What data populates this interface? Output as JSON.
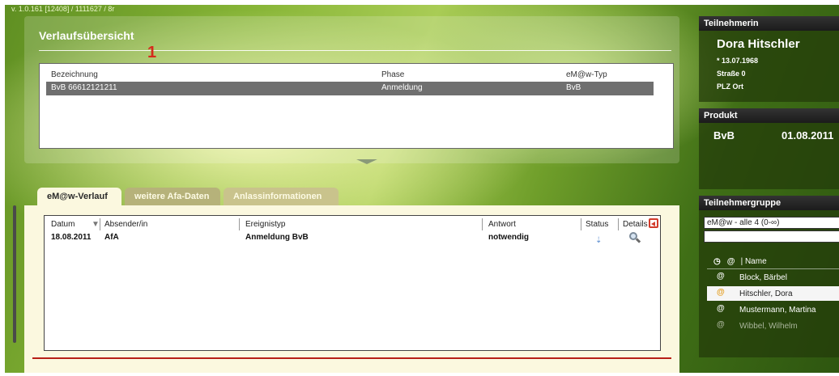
{
  "app": {
    "version": "v. 1.0.161 [12408] / 1111627 / 8r"
  },
  "annotation": {
    "badge": "1"
  },
  "verlauf": {
    "title": "Verlaufsübersicht",
    "columns": [
      "Bezeichnung",
      "Phase",
      "eM@w-Typ"
    ],
    "selected_row": {
      "bezeichnung": "BvB 66612121211",
      "phase": "Anmeldung",
      "typ": "BvB"
    }
  },
  "tabs": [
    "eM@w-Verlauf",
    "weitere Afa-Daten",
    "Anlassinformationen"
  ],
  "events": {
    "columns": [
      "Datum",
      "Absender/in",
      "Ereignistyp",
      "Antwort",
      "Status",
      "Details"
    ],
    "rows": [
      {
        "datum": "18.08.2011",
        "absender": "AfA",
        "ereignistyp": "Anmeldung BvB",
        "antwort": "notwendig"
      }
    ]
  },
  "teilnehmer": {
    "header": "Teilnehmerin",
    "name": "Dora Hitschler",
    "birth": "* 13.07.1968",
    "street": "Straße 0",
    "city": "PLZ Ort"
  },
  "produkt": {
    "header": "Produkt",
    "name": "BvB",
    "date": "01.08.2011"
  },
  "gruppe": {
    "header": "Teilnehmergruppe",
    "select_value": "eM@w - alle 4 (0-∞)",
    "col_name": "Name",
    "members": [
      "Block, Bärbel",
      "Hitschler, Dora",
      "Mustermann, Martina",
      "Wibbel, Wilhelm"
    ]
  },
  "colors": {
    "accent_red": "#d62a1c",
    "selected_row": "#6f6f6f",
    "status_icon": "#5f8fd0"
  }
}
